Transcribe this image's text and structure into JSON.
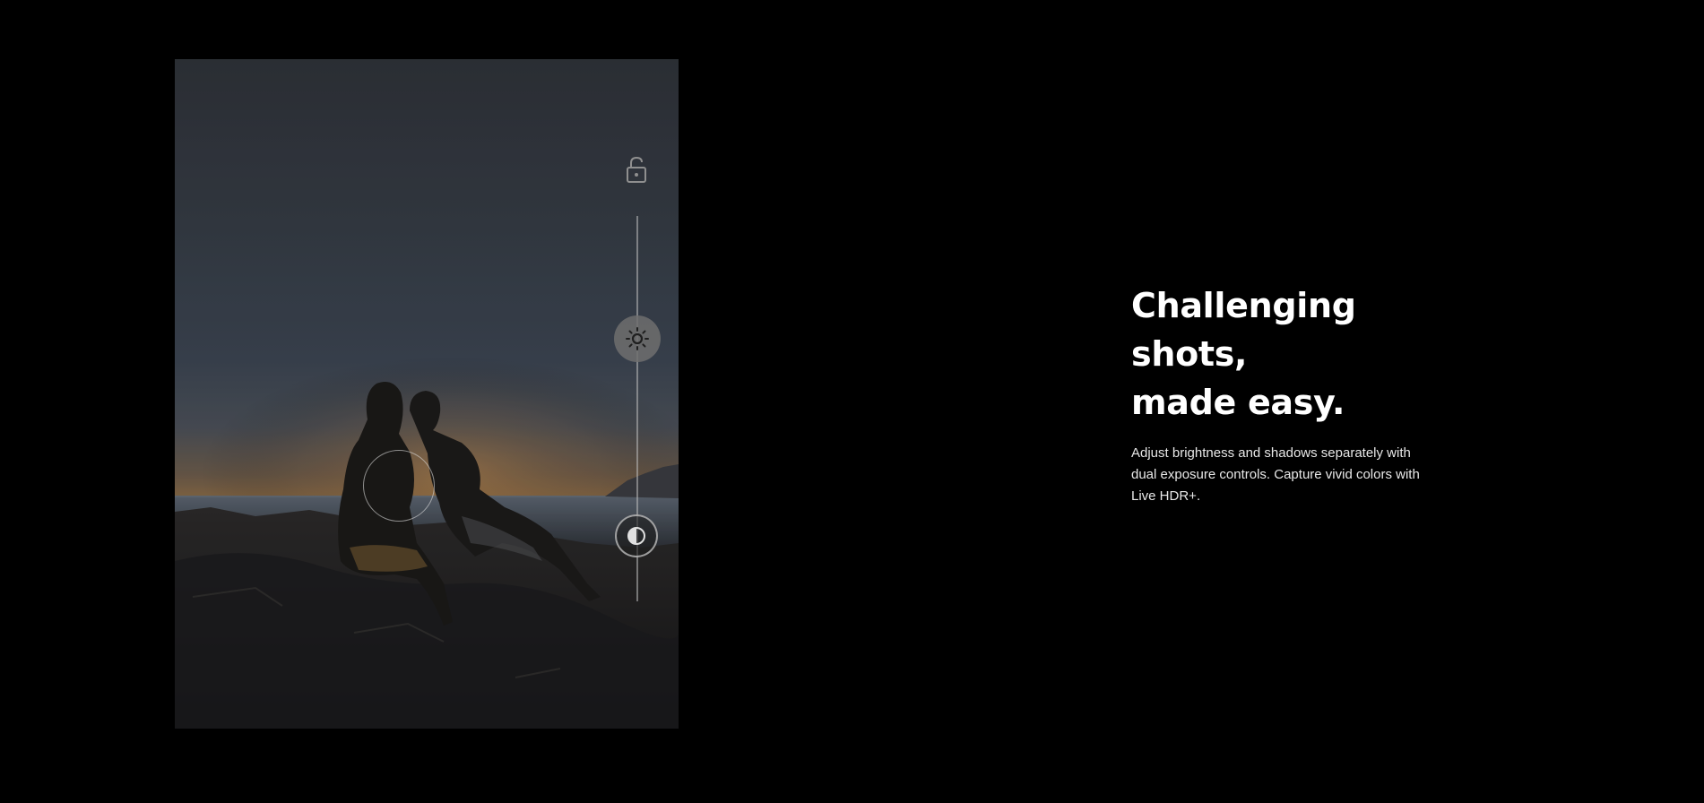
{
  "headline": {
    "line1": "Challenging",
    "line2": "shots,",
    "line3": "made easy."
  },
  "description": "Adjust brightness and shadows separately with dual exposure controls. Capture vivid colors with Live HDR+.",
  "controls": {
    "lock_icon": "unlock-icon",
    "brightness_icon": "sun-icon",
    "shadow_icon": "contrast-icon",
    "focus_icon": "focus-ring-icon"
  },
  "colors": {
    "background": "#000000",
    "text": "#ffffff"
  }
}
